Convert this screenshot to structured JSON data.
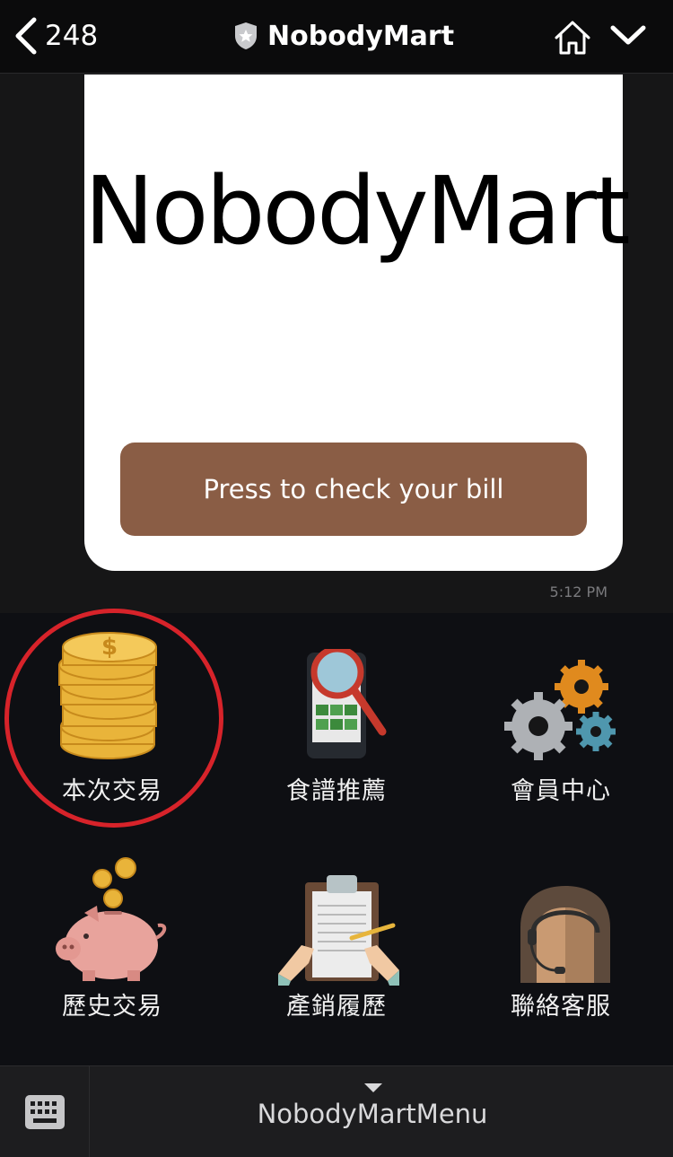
{
  "header": {
    "back_count": "248",
    "title": "NobodyMart"
  },
  "card": {
    "logo": "NobodyMart",
    "button_label": "Press to check your bill",
    "time": "5:12 PM"
  },
  "menu": {
    "items": [
      {
        "label": "本次交易",
        "icon": "coin-stack-icon"
      },
      {
        "label": "食譜推薦",
        "icon": "phone-magnifier-icon"
      },
      {
        "label": "會員中心",
        "icon": "gears-icon"
      },
      {
        "label": "歷史交易",
        "icon": "piggy-bank-icon"
      },
      {
        "label": "產銷履歷",
        "icon": "clipboard-icon"
      },
      {
        "label": "聯絡客服",
        "icon": "support-agent-icon"
      }
    ]
  },
  "bottom": {
    "menu_name": "NobodyMartMenu"
  },
  "colors": {
    "button": "#8a5d45",
    "highlight_circle": "#d7232a"
  }
}
